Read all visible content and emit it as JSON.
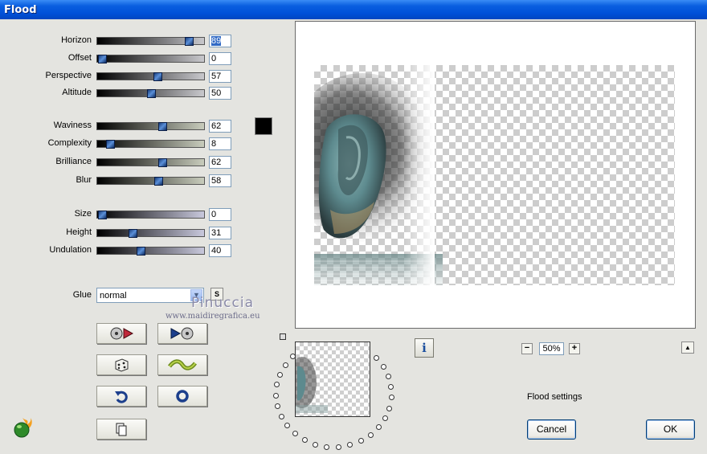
{
  "window": {
    "title": "Flood"
  },
  "params": [
    {
      "id": "horizon",
      "label": "Horizon",
      "value": "89",
      "fraction": 0.89
    },
    {
      "id": "offset",
      "label": "Offset",
      "value": "0",
      "fraction": 0.0
    },
    {
      "id": "perspective",
      "label": "Perspective",
      "value": "57",
      "fraction": 0.57
    },
    {
      "id": "altitude",
      "label": "Altitude",
      "value": "50",
      "fraction": 0.5
    },
    {
      "id": "waviness",
      "label": "Waviness",
      "value": "62",
      "fraction": 0.62
    },
    {
      "id": "complexity",
      "label": "Complexity",
      "value": "8",
      "fraction": 0.08
    },
    {
      "id": "brilliance",
      "label": "Brilliance",
      "value": "62",
      "fraction": 0.62
    },
    {
      "id": "blur",
      "label": "Blur",
      "value": "58",
      "fraction": 0.58
    },
    {
      "id": "size",
      "label": "Size",
      "value": "0",
      "fraction": 0.0
    },
    {
      "id": "height",
      "label": "Height",
      "value": "31",
      "fraction": 0.31
    },
    {
      "id": "undulation",
      "label": "Undulation",
      "value": "40",
      "fraction": 0.4
    }
  ],
  "colors": {
    "flood_color": "#000000",
    "accent": "#0054e3"
  },
  "glue": {
    "label": "Glue",
    "value": "normal",
    "s_button": "S"
  },
  "watermark": {
    "name": "Pinuccia",
    "url": "www.maidiregrafica.eu"
  },
  "tools": [
    "play-reverse-icon",
    "play-forward-icon",
    "dice-icon",
    "wave-icon",
    "undo-icon",
    "reset-icon",
    "copy-icon"
  ],
  "zoom": {
    "minus": "−",
    "value": "50%",
    "plus": "+"
  },
  "info_button": "i",
  "status_text": "Flood settings",
  "buttons": {
    "cancel": "Cancel",
    "ok": "OK"
  }
}
